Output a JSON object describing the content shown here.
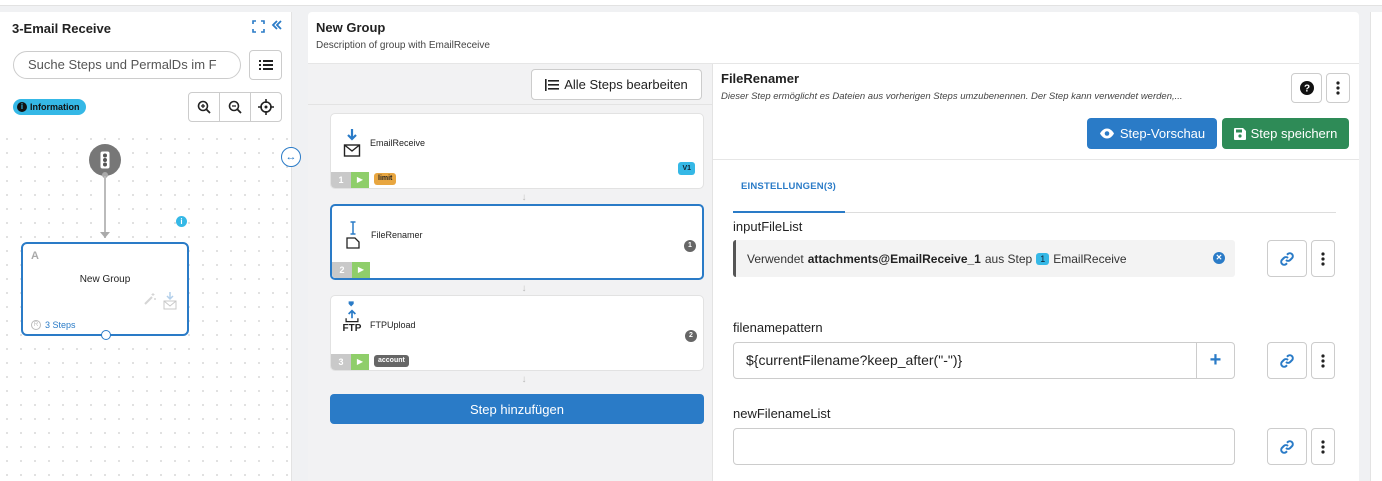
{
  "left_panel": {
    "title": "3-Email Receive",
    "search_placeholder": "Suche Steps und PermalDs im F",
    "info_badge": "Information",
    "group_node": {
      "letter": "A",
      "name": "New Group",
      "steps_label": "3 Steps"
    }
  },
  "main": {
    "title": "New Group",
    "description": "Description of group with EmailReceive"
  },
  "steps": {
    "edit_all_label": "Alle Steps bearbeiten",
    "add_step_label": "Step hinzufügen",
    "items": [
      {
        "number": "1",
        "name": "EmailReceive",
        "tag": "limit",
        "tag_color": "#e8a640",
        "version": "V1",
        "count": ""
      },
      {
        "number": "2",
        "name": "FileRenamer",
        "tag": "",
        "tag_color": "",
        "version": "",
        "count": "1"
      },
      {
        "number": "3",
        "name": "FTPUpload",
        "tag": "account",
        "tag_color": "#666666",
        "version": "",
        "count": "2",
        "icon_label": "FTP"
      }
    ]
  },
  "editor": {
    "title": "FileRenamer",
    "description": "Dieser Step ermöglicht es Dateien aus vorherigen Steps umzubenennen. Der Step kann verwendet werden,...",
    "preview_label": "Step-Vorschau",
    "save_label": "Step speichern",
    "tab_label": "EINSTELLUNGEN(3)",
    "fields": {
      "inputFileList": {
        "label": "inputFileList",
        "prefix": "Verwendet",
        "ref": "attachments@EmailReceive_1",
        "middle": "aus Step",
        "step_num": "1",
        "step_name": "EmailReceive"
      },
      "filenamepattern": {
        "label": "filenamepattern",
        "value": "${currentFilename?keep_after(\"-\")}"
      },
      "newFilenameList": {
        "label": "newFilenameList",
        "value": ""
      }
    }
  },
  "colors": {
    "accent": "#2a7bc7",
    "save": "#2e8b57",
    "info": "#35b8e6",
    "play": "#8fce6a"
  }
}
